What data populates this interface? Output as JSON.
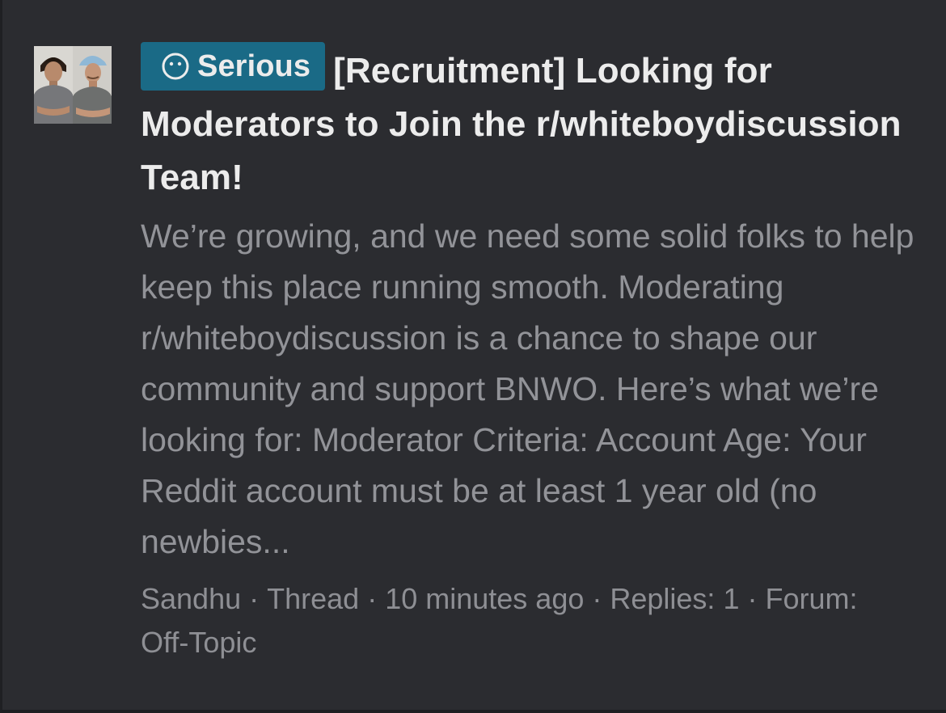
{
  "thread": {
    "prefix_label": "Serious",
    "prefix_icon": "neutral-face-icon",
    "prefix_color": "#1a6a86",
    "title": "[Recruitment] Looking for Moderators to Join the r/whiteboydiscussion Team!",
    "snippet": "We’re growing, and we need some solid folks to help keep this place running smooth. Moderating r/whiteboydiscussion is a chance to shape our community and support BNWO. Here’s what we’re looking for: Moderator Criteria: Account Age: Your Reddit account must be at least 1 year old (no newbies...",
    "author": "Sandhu",
    "content_type": "Thread",
    "time_ago": "10 minutes ago",
    "replies_label": "Replies:",
    "replies_count": "1",
    "forum_label": "Forum:",
    "forum_name": "Off-Topic",
    "separator": "·"
  }
}
